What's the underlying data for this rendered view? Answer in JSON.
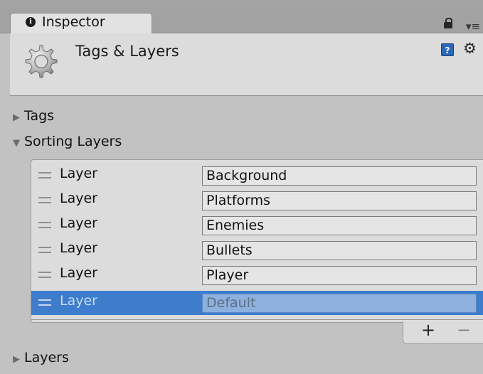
{
  "tab": {
    "title": "Inspector"
  },
  "header": {
    "title": "Tags & Layers"
  },
  "sections": {
    "tags": {
      "label": "Tags",
      "expanded": false
    },
    "sorting_layers": {
      "label": "Sorting Layers",
      "expanded": true
    },
    "layers": {
      "label": "Layers",
      "expanded": false
    }
  },
  "sorting_layers_list": [
    {
      "label": "Layer",
      "value": "Background"
    },
    {
      "label": "Layer",
      "value": "Platforms"
    },
    {
      "label": "Layer",
      "value": "Enemies"
    },
    {
      "label": "Layer",
      "value": "Bullets"
    },
    {
      "label": "Layer",
      "value": "Player"
    },
    {
      "label": "Layer",
      "value": "Default",
      "selected": true
    }
  ],
  "list_controls": {
    "add": "+",
    "remove": "−"
  },
  "colors": {
    "selection": "#3e7ccc",
    "background": "#c2c2c2",
    "panel": "#dcdcdc"
  }
}
